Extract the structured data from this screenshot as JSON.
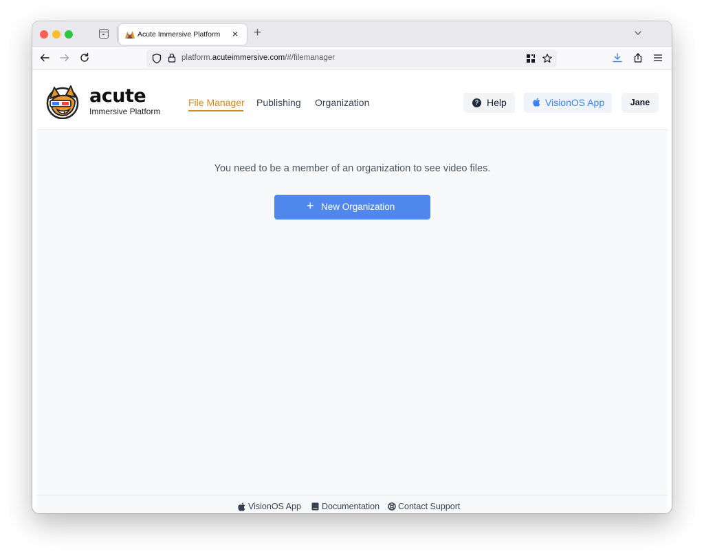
{
  "browser": {
    "tab_title": "Acute Immersive Platform",
    "tab_close": "×",
    "new_tab": "+",
    "url_prefix": "platform.",
    "url_domain": "acuteimmersive.com",
    "url_path": "/#/filemanager"
  },
  "header": {
    "brand_name": "acute",
    "brand_sub": "Immersive Platform",
    "nav": [
      "File Manager",
      "Publishing",
      "Organization"
    ],
    "active_nav": "File Manager",
    "help_label": "Help",
    "help_glyph": "?",
    "visionos_label": "VisionOS App",
    "user_label": "Jane"
  },
  "main": {
    "message": "You need to be a member of an organization to see video files.",
    "new_org_plus": "+",
    "new_org_label": "New Organization"
  },
  "footer": {
    "visionos": "VisionOS App",
    "documentation": "Documentation",
    "contact": "Contact Support"
  },
  "colors": {
    "accent": "#d9861a",
    "primary_button": "#5087ec",
    "link_blue": "#3b82f6",
    "page_bg": "#f8f9fb"
  },
  "icons": [
    "tab-list-icon",
    "back-arrow-icon",
    "forward-arrow-icon",
    "reload-icon",
    "shield-icon",
    "lock-icon",
    "qr-code-icon",
    "bookmark-star-icon",
    "download-icon",
    "share-icon",
    "menu-icon",
    "help-icon",
    "apple-icon",
    "book-icon",
    "lifebuoy-icon"
  ]
}
